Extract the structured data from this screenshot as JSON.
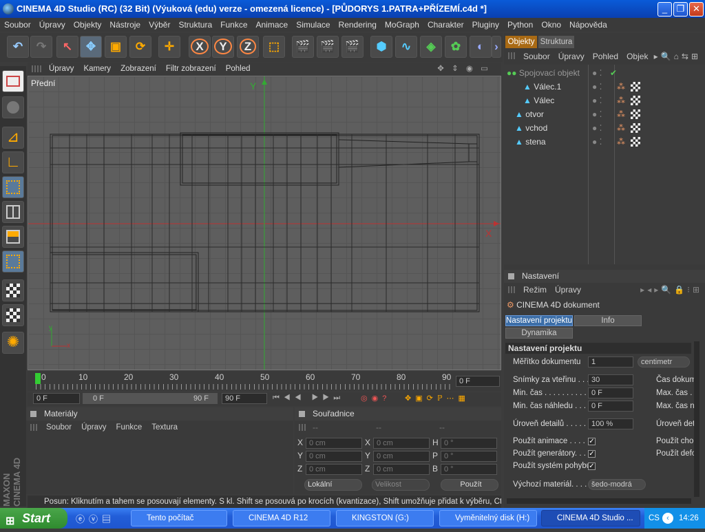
{
  "window": {
    "title": "CINEMA 4D Studio (RC) (32 Bit) (Výuková (edu) verze - omezená licence) - [PŮDORYS 1.PATRA+PŘÍZEMÍ.c4d *]"
  },
  "menu": [
    "Soubor",
    "Úpravy",
    "Objekty",
    "Nástroje",
    "Výběr",
    "Struktura",
    "Funkce",
    "Animace",
    "Simulace",
    "Rendering",
    "MoGraph",
    "Charakter",
    "Pluginy",
    "Python",
    "Okno",
    "Nápověda"
  ],
  "toolbar": {
    "x_label": "X",
    "y_label": "Y",
    "z_label": "Z"
  },
  "viewport": {
    "menu": [
      "Úpravy",
      "Kamery",
      "Zobrazení",
      "Filtr zobrazení",
      "Pohled"
    ],
    "name": "Přední",
    "axis_y": "Y",
    "axis_x": "X",
    "gizmo_x": "x",
    "gizmo_y": "y"
  },
  "timeline": {
    "ticks": [
      "0",
      "10",
      "20",
      "30",
      "40",
      "50",
      "60",
      "70",
      "80",
      "90"
    ],
    "current_frame": "0 F",
    "start": "0 F",
    "range_start": "0 F",
    "range_end": "90 F",
    "end": "90 F"
  },
  "materials": {
    "title": "Materiály",
    "menu": [
      "Soubor",
      "Úpravy",
      "Funkce",
      "Textura"
    ]
  },
  "coordinates": {
    "title": "Souřadnice",
    "cols": [
      "--",
      "--",
      "--"
    ],
    "rows": [
      {
        "a": "X",
        "av": "0 cm",
        "b": "X",
        "bv": "0 cm",
        "c": "H",
        "cv": "0 °"
      },
      {
        "a": "Y",
        "av": "0 cm",
        "b": "Y",
        "bv": "0 cm",
        "c": "P",
        "cv": "0 °"
      },
      {
        "a": "Z",
        "av": "0 cm",
        "b": "Z",
        "bv": "0 cm",
        "c": "B",
        "cv": "0 °"
      }
    ],
    "mode": "Lokální",
    "size": "Velikost",
    "apply": "Použít"
  },
  "status": "Posun: Kliknutím a tahem se posouvají elementy. S kl. Shift se posouvá po krocích (kvantizace), Shift umožňuje přidat k výběru, Ctrl odebra",
  "branding": {
    "maxon": "MAXON",
    "cinema": "CINEMA 4D"
  },
  "objects": {
    "tabs": [
      "Objekty",
      "Struktura"
    ],
    "menu": [
      "Soubor",
      "Úpravy",
      "Pohled",
      "Objek"
    ],
    "items": [
      "Spojovací objekt",
      "Válec.1",
      "Válec",
      "otvor",
      "vchod",
      "stena"
    ]
  },
  "attributes": {
    "title": "Nastavení",
    "menu": [
      "Režim",
      "Úpravy"
    ],
    "doc": "CINEMA 4D dokument",
    "tabs": [
      "Nastavení projektu",
      "Info",
      "Dynamika"
    ],
    "section": "Nastavení projektu",
    "scale_label": "Měřítko dokumentu",
    "scale_value": "1",
    "scale_unit": "centimetr",
    "fps_label": "Snímky za vteřinu . . . .",
    "fps_value": "30",
    "min_label": "Min. čas . . . . . . . . . . . .",
    "min_value": "0 F",
    "minprev_label": "Min. čas náhledu . . . .",
    "minprev_value": "0 F",
    "lod_label": "Úroveň detailů . . . . .",
    "lod_value": "100 %",
    "r_doc": "Čas dokum",
    "r_max": "Max. čas .",
    "r_maxn": "Max. čas n",
    "r_lod": "Úroveň det",
    "anim_label": "Použít animace . . . . . .",
    "gen_label": "Použít generátory. . . . .",
    "motion_label": "Použít systém pohybu",
    "r_cho": "Použít cho",
    "r_def": "Použít defo",
    "mat_label": "Výchozí materiál. . . . .",
    "mat_value": "šedo-modrá"
  },
  "taskbar": {
    "start": "Start",
    "tasks": [
      "Tento počítač",
      "CINEMA 4D R12",
      "KINGSTON (G:)",
      "Vyměnitelný disk (H:)",
      "CINEMA 4D Studio ..."
    ],
    "lang": "CS",
    "clock": "14:26"
  }
}
